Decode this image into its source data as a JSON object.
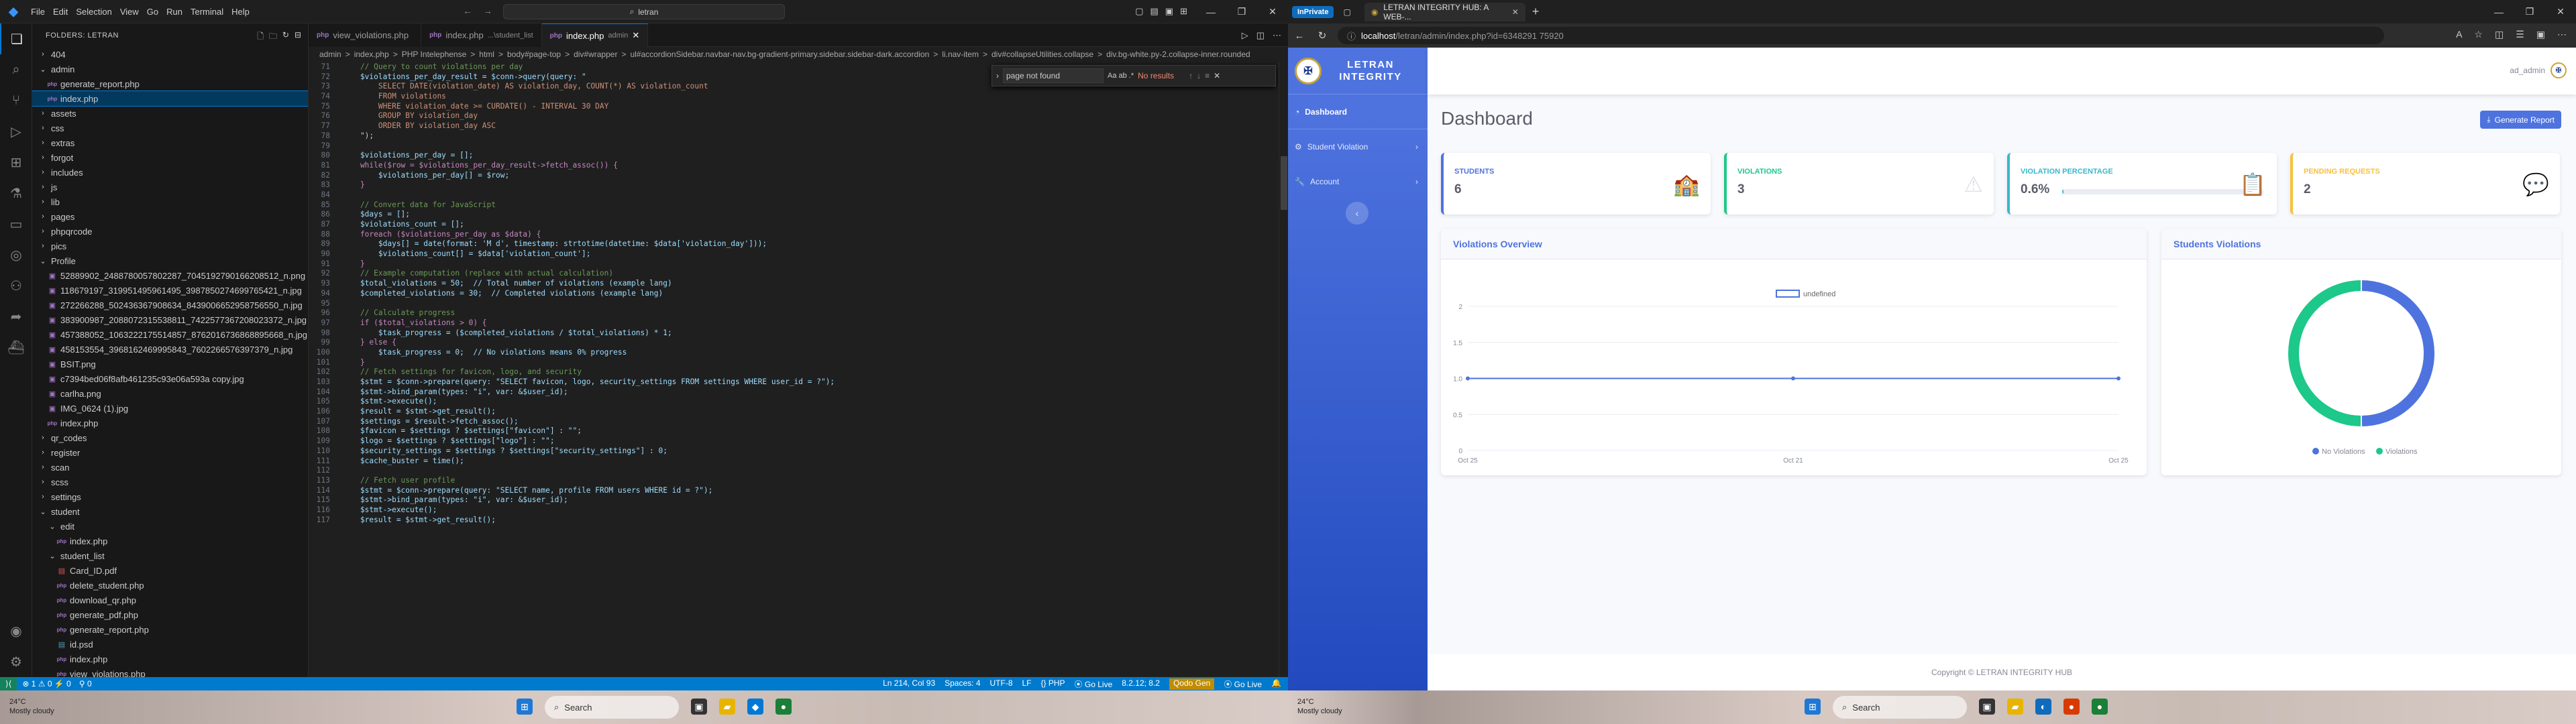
{
  "vscode": {
    "menu": [
      "File",
      "Edit",
      "Selection",
      "View",
      "Go",
      "Run",
      "Terminal",
      "Help"
    ],
    "search_text": "letran",
    "explorer_title": "FOLDERS: LETRAN",
    "tree": [
      {
        "label": "404",
        "depth": 0,
        "kind": "folder"
      },
      {
        "label": "admin",
        "depth": 0,
        "kind": "folder-open"
      },
      {
        "label": "generate_report.php",
        "depth": 1,
        "kind": "php"
      },
      {
        "label": "index.php",
        "depth": 1,
        "kind": "php",
        "selected": true
      },
      {
        "label": "assets",
        "depth": 0,
        "kind": "folder"
      },
      {
        "label": "css",
        "depth": 0,
        "kind": "folder"
      },
      {
        "label": "extras",
        "depth": 0,
        "kind": "folder"
      },
      {
        "label": "forgot",
        "depth": 0,
        "kind": "folder"
      },
      {
        "label": "includes",
        "depth": 0,
        "kind": "folder"
      },
      {
        "label": "js",
        "depth": 0,
        "kind": "folder"
      },
      {
        "label": "lib",
        "depth": 0,
        "kind": "folder"
      },
      {
        "label": "pages",
        "depth": 0,
        "kind": "folder"
      },
      {
        "label": "phpqrcode",
        "depth": 0,
        "kind": "folder"
      },
      {
        "label": "pics",
        "depth": 0,
        "kind": "folder"
      },
      {
        "label": "Profile",
        "depth": 0,
        "kind": "folder-open"
      },
      {
        "label": "52889902_2488780057802287_7045192790166208512_n.png",
        "depth": 1,
        "kind": "img"
      },
      {
        "label": "118679197_319951495961495_3987850274699765421_n.jpg",
        "depth": 1,
        "kind": "img"
      },
      {
        "label": "272266288_502436367908634_8439006652958756550_n.jpg",
        "depth": 1,
        "kind": "img"
      },
      {
        "label": "383900987_2088072315538811_7422577367208023372_n.jpg",
        "depth": 1,
        "kind": "img"
      },
      {
        "label": "457388052_1063222175514857_8762016736868895668_n.jpg",
        "depth": 1,
        "kind": "img"
      },
      {
        "label": "458153554_3968162469995843_7602266576397379_n.jpg",
        "depth": 1,
        "kind": "img"
      },
      {
        "label": "BSIT.png",
        "depth": 1,
        "kind": "img"
      },
      {
        "label": "c7394bed06f8afb461235c93e06a593a copy.jpg",
        "depth": 1,
        "kind": "img"
      },
      {
        "label": "carlha.png",
        "depth": 1,
        "kind": "img"
      },
      {
        "label": "IMG_0624 (1).jpg",
        "depth": 1,
        "kind": "img"
      },
      {
        "label": "index.php",
        "depth": 1,
        "kind": "php"
      },
      {
        "label": "qr_codes",
        "depth": 0,
        "kind": "folder"
      },
      {
        "label": "register",
        "depth": 0,
        "kind": "folder"
      },
      {
        "label": "scan",
        "depth": 0,
        "kind": "folder"
      },
      {
        "label": "scss",
        "depth": 0,
        "kind": "folder"
      },
      {
        "label": "settings",
        "depth": 0,
        "kind": "folder"
      },
      {
        "label": "student",
        "depth": 0,
        "kind": "folder-open"
      },
      {
        "label": "edit",
        "depth": 1,
        "kind": "folder-open"
      },
      {
        "label": "index.php",
        "depth": 2,
        "kind": "php"
      },
      {
        "label": "student_list",
        "depth": 1,
        "kind": "folder-open"
      },
      {
        "label": "Card_ID.pdf",
        "depth": 2,
        "kind": "pdf"
      },
      {
        "label": "delete_student.php",
        "depth": 2,
        "kind": "php"
      },
      {
        "label": "download_qr.php",
        "depth": 2,
        "kind": "php"
      },
      {
        "label": "generate_pdf.php",
        "depth": 2,
        "kind": "php"
      },
      {
        "label": "generate_report.php",
        "depth": 2,
        "kind": "php"
      },
      {
        "label": "id.psd",
        "depth": 2,
        "kind": "psd"
      },
      {
        "label": "index.php",
        "depth": 2,
        "kind": "php"
      },
      {
        "label": "view_violations.php",
        "depth": 2,
        "kind": "php"
      }
    ],
    "tabs": [
      {
        "label": "view_violations.php",
        "sub": "",
        "active": false
      },
      {
        "label": "index.php",
        "sub": "...\\student_list",
        "active": false
      },
      {
        "label": "index.php",
        "sub": "admin",
        "active": true
      }
    ],
    "breadcrumbs": [
      "admin",
      ">",
      "index.php",
      ">",
      "PHP Intelephense",
      ">",
      "html",
      ">",
      "body#page-top",
      ">",
      "div#wrapper",
      ">",
      "ul#accordionSidebar.navbar-nav.bg-gradient-primary.sidebar.sidebar-dark.accordion",
      ">",
      "li.nav-item",
      ">",
      "div#collapseUtilities.collapse",
      ">",
      "div.bg-white.py-2.collapse-inner.rounded"
    ],
    "find": {
      "value": "page not found",
      "opts": "Aa ab .*",
      "result": "No results"
    },
    "code_lines": [
      {
        "n": "71",
        "t": "    // Query to count violations per day"
      },
      {
        "n": "72",
        "t": "    $violations_per_day_result = $conn->query(query: \""
      },
      {
        "n": "73",
        "t": "        SELECT DATE(violation_date) AS violation_day, COUNT(*) AS violation_count"
      },
      {
        "n": "74",
        "t": "        FROM violations"
      },
      {
        "n": "75",
        "t": "        WHERE violation_date >= CURDATE() - INTERVAL 30 DAY"
      },
      {
        "n": "76",
        "t": "        GROUP BY violation_day"
      },
      {
        "n": "77",
        "t": "        ORDER BY violation_day ASC"
      },
      {
        "n": "78",
        "t": "    \");"
      },
      {
        "n": "79",
        "t": ""
      },
      {
        "n": "80",
        "t": "    $violations_per_day = [];"
      },
      {
        "n": "81",
        "t": "    while($row = $violations_per_day_result->fetch_assoc()) {"
      },
      {
        "n": "82",
        "t": "        $violations_per_day[] = $row;"
      },
      {
        "n": "83",
        "t": "    }"
      },
      {
        "n": "84",
        "t": ""
      },
      {
        "n": "85",
        "t": "    // Convert data for JavaScript"
      },
      {
        "n": "86",
        "t": "    $days = [];"
      },
      {
        "n": "87",
        "t": "    $violations_count = [];"
      },
      {
        "n": "88",
        "t": "    foreach ($violations_per_day as $data) {"
      },
      {
        "n": "89",
        "t": "        $days[] = date(format: 'M d', timestamp: strtotime(datetime: $data['violation_day']));"
      },
      {
        "n": "90",
        "t": "        $violations_count[] = $data['violation_count'];"
      },
      {
        "n": "91",
        "t": "    }"
      },
      {
        "n": "92",
        "t": "    // Example computation (replace with actual calculation)"
      },
      {
        "n": "93",
        "t": "    $total_violations = 50;  // Total number of violations (example lang)"
      },
      {
        "n": "94",
        "t": "    $completed_violations = 30;  // Completed violations (example lang)"
      },
      {
        "n": "95",
        "t": ""
      },
      {
        "n": "96",
        "t": "    // Calculate progress"
      },
      {
        "n": "97",
        "t": "    if ($total_violations > 0) {"
      },
      {
        "n": "98",
        "t": "        $task_progress = ($completed_violations / $total_violations) * 1;"
      },
      {
        "n": "99",
        "t": "    } else {"
      },
      {
        "n": "100",
        "t": "        $task_progress = 0;  // No violations means 0% progress"
      },
      {
        "n": "101",
        "t": "    }"
      },
      {
        "n": "102",
        "t": "    // Fetch settings for favicon, logo, and security"
      },
      {
        "n": "103",
        "t": "    $stmt = $conn->prepare(query: \"SELECT favicon, logo, security_settings FROM settings WHERE user_id = ?\");"
      },
      {
        "n": "104",
        "t": "    $stmt->bind_param(types: \"i\", var: &$user_id);"
      },
      {
        "n": "105",
        "t": "    $stmt->execute();"
      },
      {
        "n": "106",
        "t": "    $result = $stmt->get_result();"
      },
      {
        "n": "107",
        "t": "    $settings = $result->fetch_assoc();"
      },
      {
        "n": "108",
        "t": "    $favicon = $settings ? $settings[\"favicon\"] : \"\";"
      },
      {
        "n": "109",
        "t": "    $logo = $settings ? $settings[\"logo\"] : \"\";"
      },
      {
        "n": "110",
        "t": "    $security_settings = $settings ? $settings[\"security_settings\"] : 0;"
      },
      {
        "n": "111",
        "t": "    $cache_buster = time();"
      },
      {
        "n": "112",
        "t": ""
      },
      {
        "n": "113",
        "t": "    // Fetch user profile"
      },
      {
        "n": "114",
        "t": "    $stmt = $conn->prepare(query: \"SELECT name, profile FROM users WHERE id = ?\");"
      },
      {
        "n": "115",
        "t": "    $stmt->bind_param(types: \"i\", var: &$user_id);"
      },
      {
        "n": "116",
        "t": "    $stmt->execute();"
      },
      {
        "n": "117",
        "t": "    $result = $stmt->get_result();"
      }
    ],
    "status": {
      "left": [
        "⊗ 1 ⚠ 0 ⚡ 0",
        "⚲ 0"
      ],
      "right": [
        "Ln 214, Col 93",
        "Spaces: 4",
        "UTF-8",
        "LF",
        "{} PHP",
        "⦿ Go Live",
        "8.2.12; 8.2",
        "Qodo Gen",
        "⦿ Go Live",
        "🔔"
      ]
    }
  },
  "browser": {
    "inprivate_label": "InPrivate",
    "tab_title": "LETRAN INTEGRITY HUB: A WEB-...",
    "url_host": "localhost",
    "url_path": "/letran/admin/index.php?id=6348291 75920",
    "brand": "LETRAN INTEGRITY",
    "nav": [
      {
        "label": "Dashboard",
        "icon": "dashboard-icon",
        "active": true,
        "has_arrow": false
      },
      {
        "label": "Student Violation",
        "icon": "gear-icon",
        "active": false,
        "has_arrow": true
      },
      {
        "label": "Account",
        "icon": "wrench-icon",
        "active": false,
        "has_arrow": true
      }
    ],
    "user_name": "ad_admin",
    "page_title": "Dashboard",
    "generate_report": "Generate Report",
    "cards": [
      {
        "label": "STUDENTS",
        "value": "6",
        "color": "#4e73df",
        "icon": "🏫"
      },
      {
        "label": "VIOLATIONS",
        "value": "3",
        "color": "#1cc88a",
        "icon": "⚠"
      },
      {
        "label": "VIOLATION PERCENTAGE",
        "value": "0.6%",
        "color": "#36b9cc",
        "icon": "📋",
        "progress": 0.6
      },
      {
        "label": "PENDING REQUESTS",
        "value": "2",
        "color": "#f6c23e",
        "icon": "💬"
      }
    ],
    "overview_title": "Violations Overview",
    "pie_title": "Students Violations",
    "footer": "Copyright © LETRAN INTEGRITY HUB"
  },
  "chart_data": [
    {
      "type": "line",
      "title": "Violations Overview",
      "legend": "undefined",
      "legend_position": "top",
      "x": [
        "Oct 25",
        "Oct 21",
        "Oct 25"
      ],
      "series": [
        {
          "name": "undefined",
          "values": [
            1,
            1,
            1
          ]
        }
      ],
      "y_ticks": [
        "2",
        "1.5",
        "1.0",
        "0.5",
        "0"
      ],
      "ylim": [
        0,
        2
      ],
      "color": "#4e73df"
    },
    {
      "type": "pie",
      "title": "Students Violations",
      "labels": [
        "No Violations",
        "Violations"
      ],
      "values": [
        50,
        50
      ],
      "colors": [
        "#4e73df",
        "#1cc88a"
      ],
      "legend_position": "bottom"
    }
  ],
  "taskbar": {
    "search": "Search",
    "weather_left": "24°C\nMostly cloudy",
    "weather_right": "24°C\nMostly cloudy"
  }
}
